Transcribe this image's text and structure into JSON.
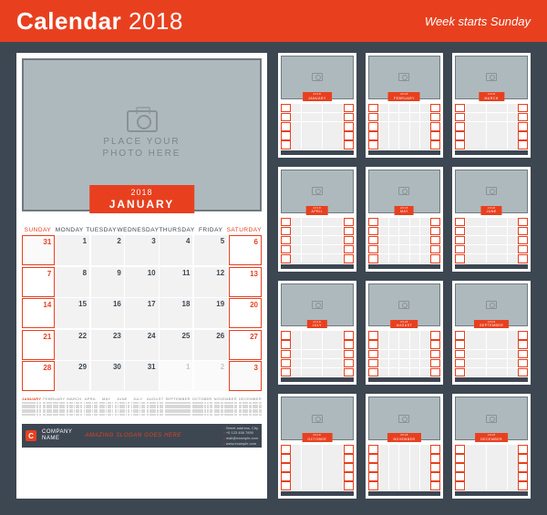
{
  "header": {
    "title_a": "Calendar",
    "title_b": " 2018",
    "subtitle": "Week starts Sunday"
  },
  "main": {
    "photo_placeholder_l1": "PLACE YOUR",
    "photo_placeholder_l2": "PHOTO HERE",
    "year": "2018",
    "month": "JANUARY",
    "dow": [
      "SUNDAY",
      "MONDAY",
      "TUESDAY",
      "WEDNESDAY",
      "THURSDAY",
      "FRIDAY",
      "SATURDAY"
    ],
    "cells": [
      {
        "n": "31",
        "out": true,
        "we": true
      },
      {
        "n": "1"
      },
      {
        "n": "2"
      },
      {
        "n": "3"
      },
      {
        "n": "4"
      },
      {
        "n": "5"
      },
      {
        "n": "6",
        "we": true
      },
      {
        "n": "7",
        "we": true
      },
      {
        "n": "8"
      },
      {
        "n": "9"
      },
      {
        "n": "10"
      },
      {
        "n": "11"
      },
      {
        "n": "12"
      },
      {
        "n": "13",
        "we": true
      },
      {
        "n": "14",
        "we": true
      },
      {
        "n": "15"
      },
      {
        "n": "16"
      },
      {
        "n": "17"
      },
      {
        "n": "18"
      },
      {
        "n": "19"
      },
      {
        "n": "20",
        "we": true
      },
      {
        "n": "21",
        "we": true
      },
      {
        "n": "22"
      },
      {
        "n": "23"
      },
      {
        "n": "24"
      },
      {
        "n": "25"
      },
      {
        "n": "26"
      },
      {
        "n": "27",
        "we": true
      },
      {
        "n": "28",
        "we": true
      },
      {
        "n": "29"
      },
      {
        "n": "30"
      },
      {
        "n": "31"
      },
      {
        "n": "1",
        "out": true
      },
      {
        "n": "2",
        "out": true
      },
      {
        "n": "3",
        "out": true,
        "we": true
      }
    ],
    "mini_months": [
      "JANUARY",
      "FEBRUARY",
      "MARCH",
      "APRIL",
      "MAY",
      "JUNE",
      "JULY",
      "AUGUST",
      "SEPTEMBER",
      "OCTOBER",
      "NOVEMBER",
      "DECEMBER"
    ]
  },
  "footer": {
    "logo_letter": "C",
    "company_l1": "COMPANY",
    "company_l2": "NAME",
    "slogan": "AMAZING SLOGAN GOES HERE",
    "contact": [
      "Street address, City",
      "+0 123 456 7890",
      "mail@example.com",
      "www.example.com"
    ]
  },
  "thumbs": [
    {
      "year": "2018",
      "month": "JANUARY"
    },
    {
      "year": "2018",
      "month": "FEBRUARY"
    },
    {
      "year": "2018",
      "month": "MARCH"
    },
    {
      "year": "2018",
      "month": "APRIL"
    },
    {
      "year": "2018",
      "month": "MAY"
    },
    {
      "year": "2018",
      "month": "JUNE"
    },
    {
      "year": "2018",
      "month": "JULY"
    },
    {
      "year": "2018",
      "month": "AUGUST"
    },
    {
      "year": "2018",
      "month": "SEPTEMBER"
    },
    {
      "year": "2018",
      "month": "OCTOBER"
    },
    {
      "year": "2018",
      "month": "NOVEMBER"
    },
    {
      "year": "2018",
      "month": "DECEMBER"
    }
  ]
}
